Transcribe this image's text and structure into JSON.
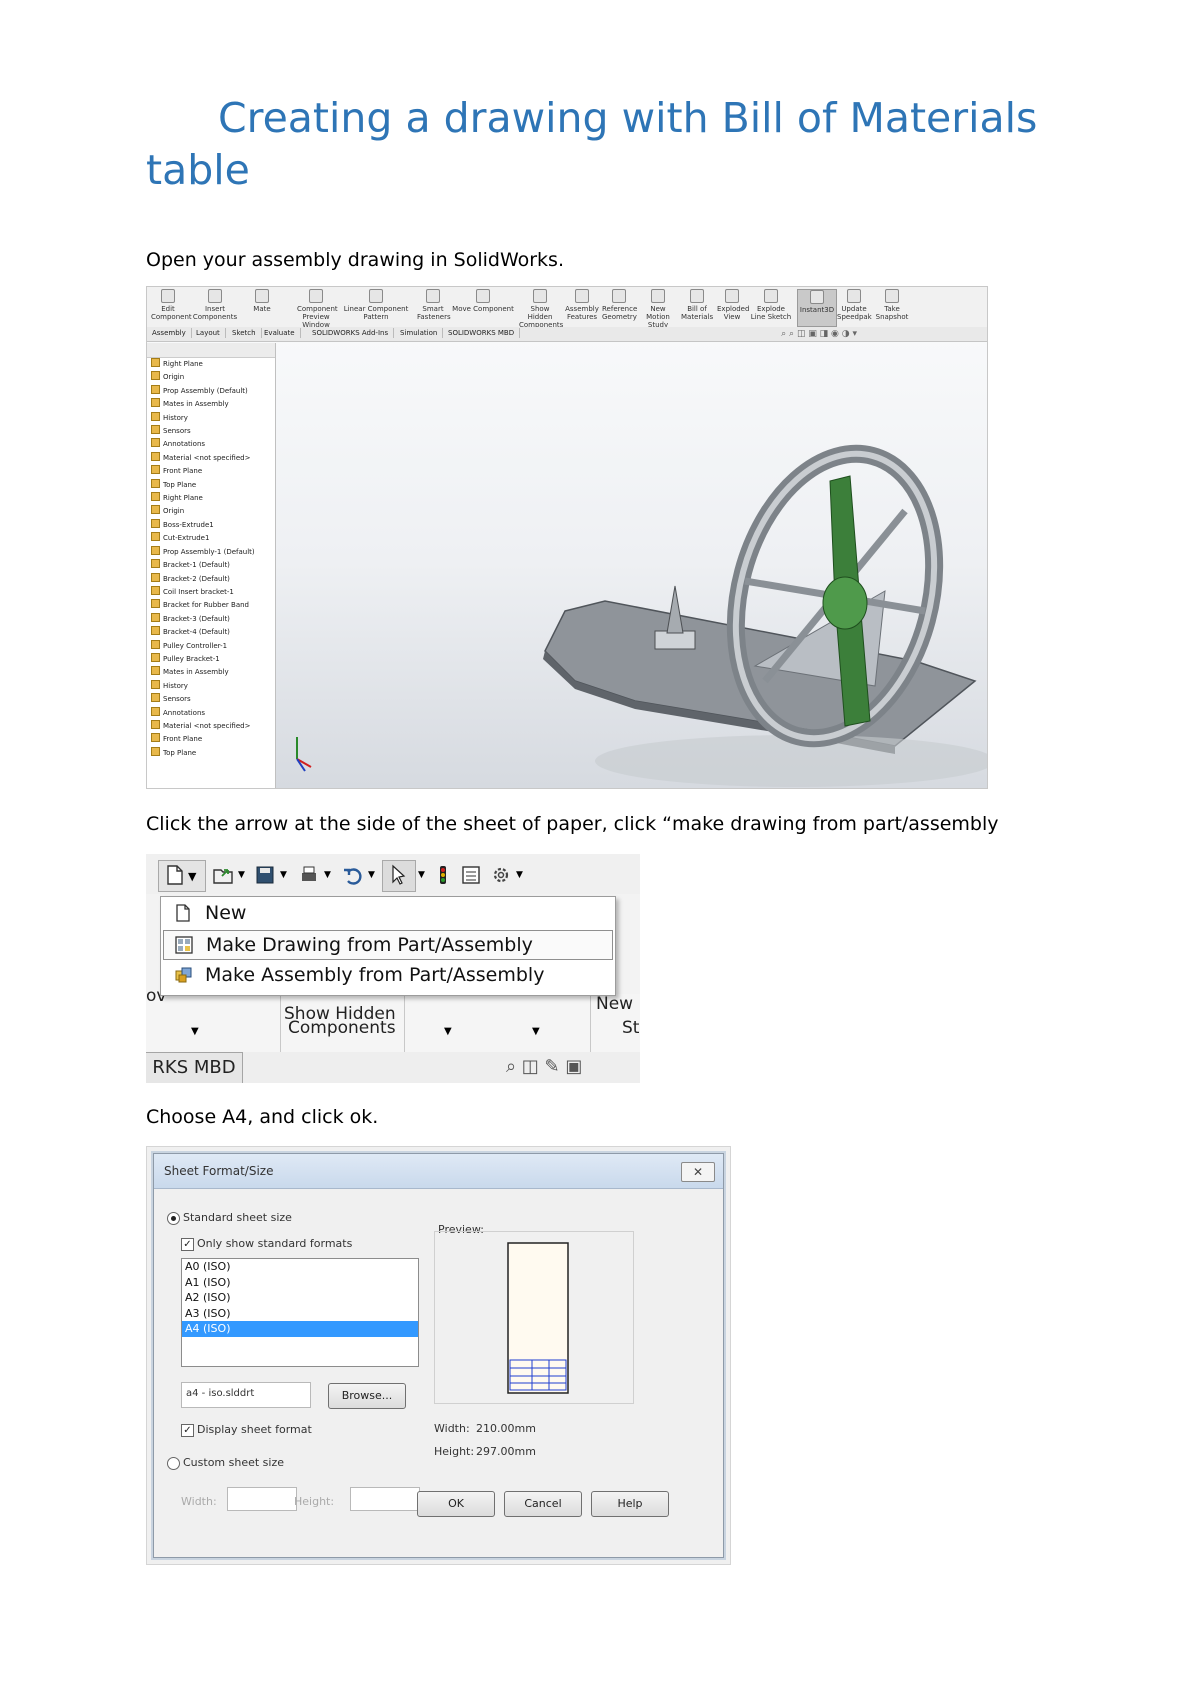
{
  "document": {
    "title": "Creating a drawing with Bill of Materials table",
    "step1": "Open your assembly drawing in SolidWorks.",
    "step2": "Click the arrow at the side of the sheet of paper, click “make drawing from part/assembly",
    "step3": "Choose A4, and click ok."
  },
  "solidworks": {
    "ribbon": [
      {
        "label": "Edit Component"
      },
      {
        "label": "Insert Components"
      },
      {
        "label": "Mate"
      },
      {
        "label": "Component Preview Window"
      },
      {
        "label": "Linear Component Pattern"
      },
      {
        "label": "Smart Fasteners"
      },
      {
        "label": "Move Component"
      },
      {
        "label": "Show Hidden Components"
      },
      {
        "label": "Assembly Features"
      },
      {
        "label": "Reference Geometry"
      },
      {
        "label": "New Motion Study"
      },
      {
        "label": "Bill of Materials"
      },
      {
        "label": "Exploded View"
      },
      {
        "label": "Explode Line Sketch"
      },
      {
        "label": "Instant3D"
      },
      {
        "label": "Update Speedpak"
      },
      {
        "label": "Take Snapshot"
      }
    ],
    "tabs": [
      "Assembly",
      "Layout",
      "Sketch",
      "Evaluate",
      "SOLIDWORKS Add-Ins",
      "Simulation",
      "SOLIDWORKS MBD"
    ],
    "tree": [
      "Right Plane",
      "Origin",
      "Prop Assembly (Default)",
      "Mates in Assembly",
      "History",
      "Sensors",
      "Annotations",
      "Material <not specified>",
      "Front Plane",
      "Top Plane",
      "Right Plane",
      "Origin",
      "Boss-Extrude1",
      "Cut-Extrude1",
      "Prop Assembly-1 (Default)",
      "Bracket-1 (Default)",
      "Bracket-2 (Default)",
      "Coil Insert bracket-1",
      "Bracket for Rubber Band",
      "Bracket-3 (Default)",
      "Bracket-4 (Default)",
      "Pulley Controller-1",
      "Pulley Bracket-1",
      "Mates in Assembly",
      "History",
      "Sensors",
      "Annotations",
      "Material <not specified>",
      "Front Plane",
      "Top Plane"
    ]
  },
  "menu": {
    "items": [
      "New",
      "Make Drawing from Part/Assembly",
      "Make Assembly from Part/Assembly"
    ],
    "behind_show_hidden": "Show Hidden",
    "behind_components": "Components",
    "behind_new": "New",
    "behind_st": "St",
    "behind_ov": "ov",
    "mbd_tab": "RKS MBD"
  },
  "dialog": {
    "title": "Sheet Format/Size",
    "standard_size": "Standard sheet size",
    "only_standard": "Only show standard formats",
    "sizes": [
      "A0 (ISO)",
      "A1 (ISO)",
      "A2 (ISO)",
      "A3 (ISO)",
      "A4 (ISO)"
    ],
    "selected_size": "A4 (ISO)",
    "format_file": "a4 - iso.slddrt",
    "browse": "Browse...",
    "display_format": "Display sheet format",
    "custom_size": "Custom sheet size",
    "width_label": "Width:",
    "height_label": "Height:",
    "preview_label": "Preview:",
    "preview_width_label": "Width:",
    "preview_width": "210.00mm",
    "preview_height_label": "Height:",
    "preview_height": "297.00mm",
    "ok": "OK",
    "cancel": "Cancel",
    "help": "Help",
    "close": "✕"
  },
  "colors": {
    "title": "#2e75b6",
    "selection": "#3399ff",
    "green_part": "#3c7f3a"
  }
}
